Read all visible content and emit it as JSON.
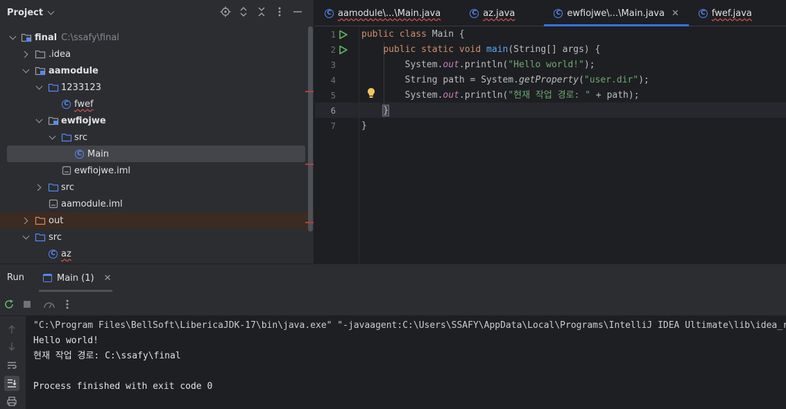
{
  "project": {
    "title": "Project",
    "tree": [
      {
        "label": "final",
        "path": "C:\\ssafy\\final",
        "bold": true
      },
      {
        "label": ".idea"
      },
      {
        "label": "aamodule",
        "bold": true
      },
      {
        "label": "1233123"
      },
      {
        "label": "fwef",
        "underline": true
      },
      {
        "label": "ewfiojwe",
        "bold": true
      },
      {
        "label": "src"
      },
      {
        "label": "Main"
      },
      {
        "label": "ewfiojwe.iml"
      },
      {
        "label": "src"
      },
      {
        "label": "aamodule.iml"
      },
      {
        "label": "out"
      },
      {
        "label": "src"
      },
      {
        "label": "az",
        "underline": true
      }
    ]
  },
  "editor": {
    "tabs": [
      {
        "label": "aamodule\\...\\Main.java"
      },
      {
        "label": "az.java"
      },
      {
        "label": "ewfiojwe\\...\\Main.java",
        "active": true
      },
      {
        "label": "fwef.java"
      }
    ],
    "line_numbers": [
      "1",
      "2",
      "3",
      "4",
      "5",
      "6",
      "7"
    ],
    "code": {
      "l1_kw1": "public",
      "l1_kw2": "class",
      "l1_rest": " Main {",
      "l2_kw1": "public",
      "l2_kw2": "static",
      "l2_kw3": "void",
      "l2_fn": "main",
      "l2_rest": "(String[] args) {",
      "l3_a": "System.",
      "l3_field": "out",
      "l3_b": ".println(",
      "l3_str": "\"Hello world!\"",
      "l3_c": ");",
      "l4_a": "String path = System.",
      "l4_method": "getProperty",
      "l4_b": "(",
      "l4_str": "\"user.dir\"",
      "l4_c": ");",
      "l5_a": "System.",
      "l5_field": "out",
      "l5_b": ".println(",
      "l5_str": "\"현재 작업 경로: \"",
      "l5_c": " + path);",
      "l6": "}",
      "l7": "}"
    }
  },
  "run": {
    "title": "Run",
    "tab_label": "Main (1)",
    "console": [
      "\"C:\\Program Files\\BellSoft\\LibericaJDK-17\\bin\\java.exe\" \"-javaagent:C:\\Users\\SSAFY\\AppData\\Local\\Programs\\IntelliJ IDEA Ultimate\\lib\\idea_rt.jar",
      "Hello world!",
      "현재 작업 경로: C:\\ssafy\\final",
      "",
      "Process finished with exit code 0"
    ]
  },
  "colors": {
    "accent": "#3574f0",
    "run_green": "#5fb865",
    "class_blue": "#548af7",
    "error_red": "#b0413e"
  }
}
